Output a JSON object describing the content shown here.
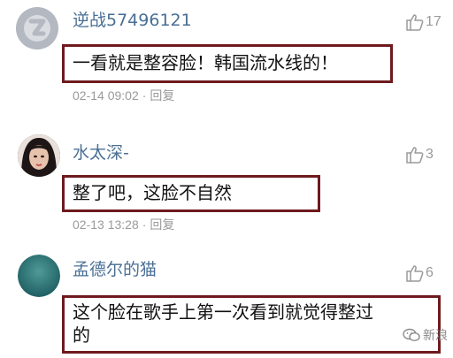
{
  "comments": [
    {
      "username": "逆战57496121",
      "avatar": "default-avatar",
      "like_count": "17",
      "content": "一看就是整容脸！韩国流水线的！",
      "date": "02-14 09:02",
      "separator": "·",
      "reply_label": "回复"
    },
    {
      "username": "水太深-",
      "avatar": "portrait-avatar",
      "like_count": "3",
      "content": "整了吧，这脸不自然",
      "date": "02-13 13:28",
      "separator": "·",
      "reply_label": "回复"
    },
    {
      "username": "孟德尔的猫",
      "avatar": "teal-avatar",
      "like_count": "6",
      "content_lines": [
        "这个脸在歌手上第一次看到就觉得整过",
        "的"
      ]
    }
  ],
  "watermark": {
    "icon": "wechat-icon",
    "text": "新浪"
  },
  "colors": {
    "username": "#4a6f95",
    "box_border": "#6e1a1e",
    "meta": "#9a9a9a"
  }
}
